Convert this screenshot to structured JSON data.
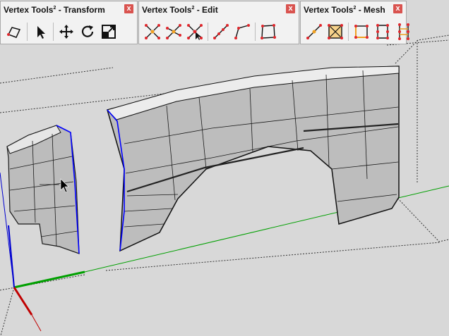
{
  "toolbars": [
    {
      "title": "Vertex Tools",
      "suffix": " - Transform",
      "close": "x",
      "buttons": [
        {
          "icon": "polygon-select-icon"
        },
        {
          "icon": "cursor-arrow-icon"
        },
        {
          "icon": "move-arrows-icon"
        },
        {
          "icon": "rotate-icon"
        },
        {
          "icon": "scale-icon"
        }
      ]
    },
    {
      "title": "Vertex Tools",
      "suffix": " - Edit",
      "close": "x",
      "buttons": [
        {
          "icon": "merge-vertices-icon"
        },
        {
          "icon": "merge-to-point-icon"
        },
        {
          "icon": "collapse-vertices-icon"
        },
        {
          "icon": "line-vertices-icon"
        },
        {
          "icon": "bend-line-icon"
        },
        {
          "icon": "quad-vertices-icon"
        }
      ]
    },
    {
      "title": "Vertex Tools",
      "suffix": " - Mesh",
      "close": "x",
      "buttons": [
        {
          "icon": "connect-line-icon"
        },
        {
          "icon": "cross-quad-icon"
        },
        {
          "icon": "quad-corners-icon"
        },
        {
          "icon": "split-edge-icon"
        },
        {
          "icon": "column-loop-icon"
        }
      ]
    }
  ],
  "superscript": "2",
  "colors": {
    "viewport_bg": "#d8d8d8",
    "mesh_face": "#b9b9b9",
    "mesh_edge": "#1c1c1c",
    "selected_edge": "#0000ff",
    "axis_green": "#00a000",
    "axis_red": "#c00000",
    "vertex_red": "#e0262b",
    "close_red": "#d9534f"
  }
}
